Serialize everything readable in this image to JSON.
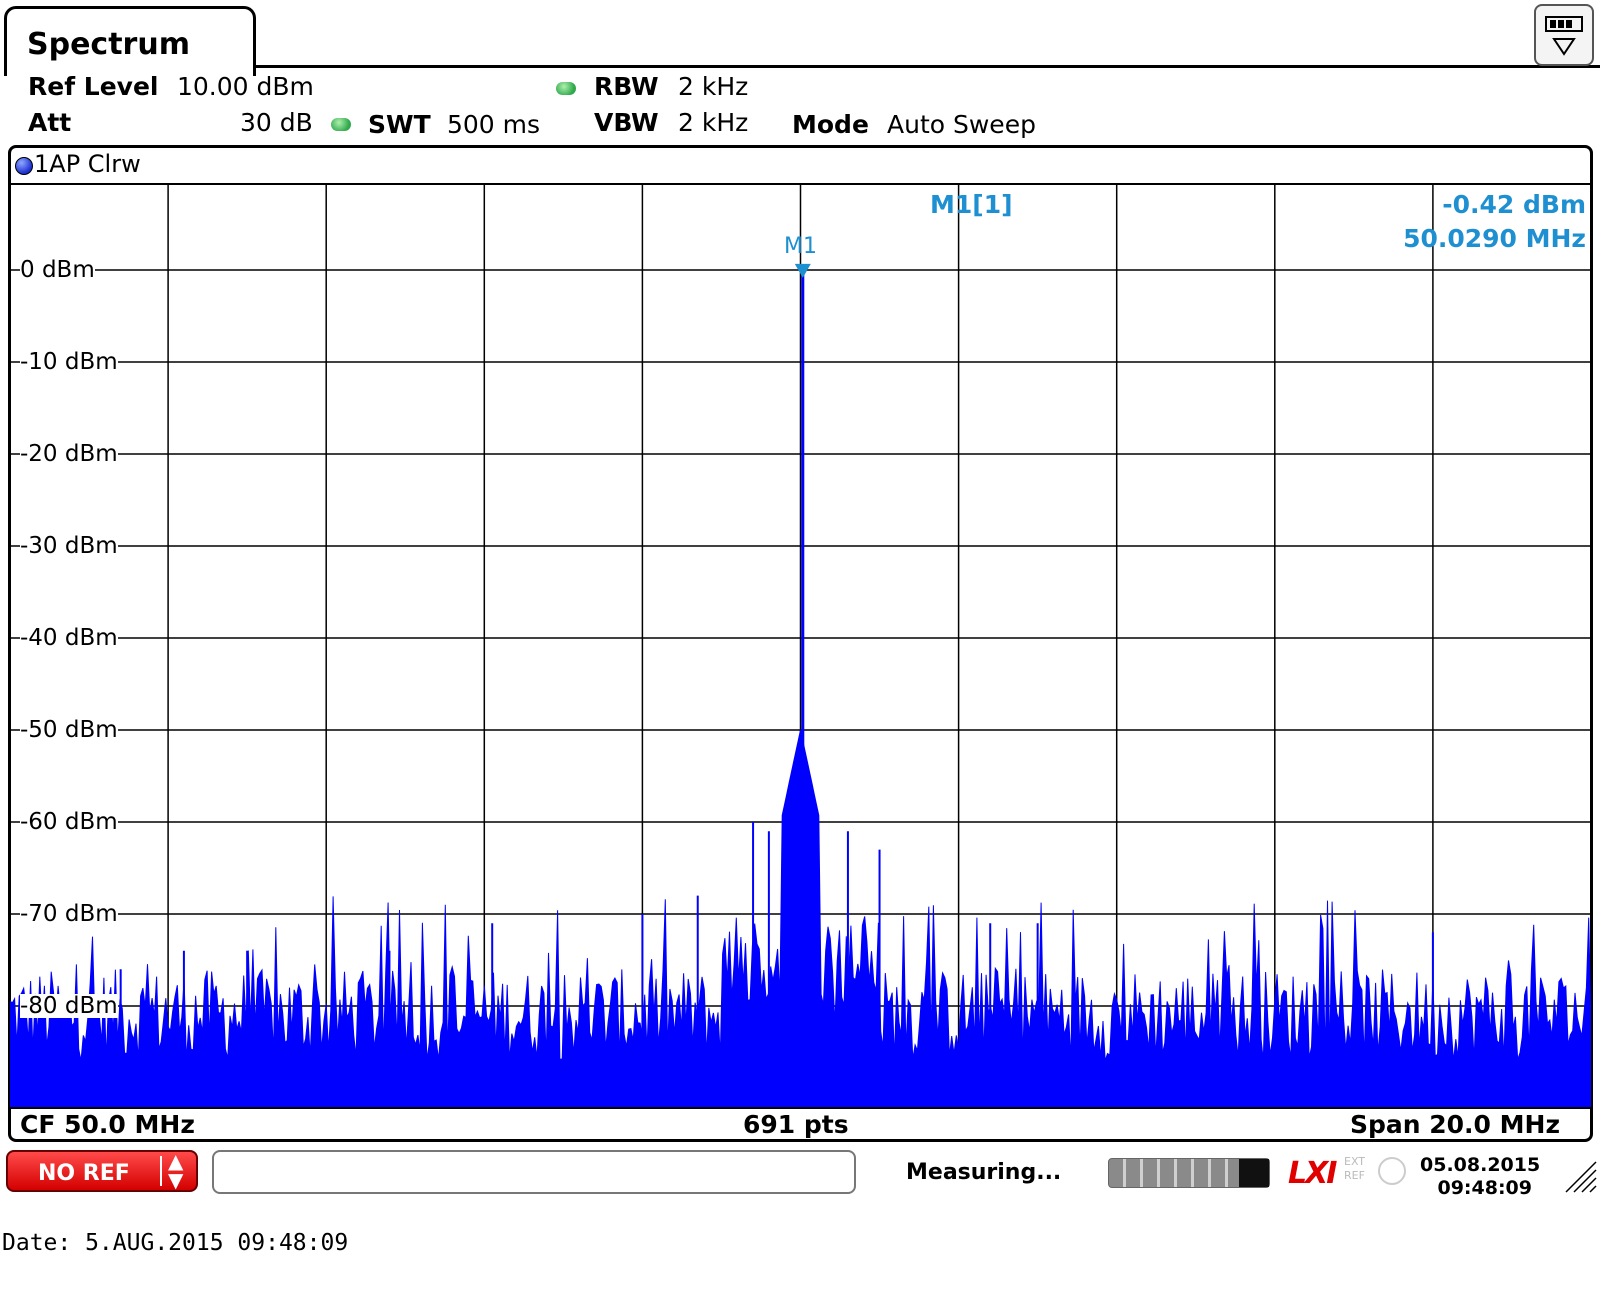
{
  "tab": {
    "title": "Spectrum"
  },
  "header": {
    "ref_level_label": "Ref Level",
    "ref_level_value": "10.00 dBm",
    "att_label": "Att",
    "att_value": "30 dB",
    "swt_label": "SWT",
    "swt_value": "500 ms",
    "rbw_label": "RBW",
    "rbw_value": "2 kHz",
    "vbw_label": "VBW",
    "vbw_value": "2 kHz",
    "mode_label": "Mode",
    "mode_value": "Auto Sweep"
  },
  "trace": {
    "label": "1AP Clrw",
    "color": "#0000ff"
  },
  "marker": {
    "name": "M1",
    "readout_name": "M1[1]",
    "level": "-0.42 dBm",
    "frequency": "50.0290 MHz",
    "color": "#1e8fd0"
  },
  "y_axis_labels": [
    "0 dBm",
    "-10 dBm",
    "-20 dBm",
    "-30 dBm",
    "-40 dBm",
    "-50 dBm",
    "-60 dBm",
    "-70 dBm",
    "-80 dBm"
  ],
  "footer": {
    "cf": "CF 50.0 MHz",
    "pts": "691 pts",
    "span": "Span 20.0 MHz"
  },
  "statusbar": {
    "noref": "NO REF",
    "status": "Measuring...",
    "date": "05.08.2015",
    "time": "09:48:09",
    "lxi": "LXI",
    "ext_ref": [
      "EXT",
      "REF"
    ]
  },
  "date_line": "Date: 5.AUG.2015   09:48:09",
  "chart_data": {
    "type": "line",
    "ylim": [
      -90,
      10
    ],
    "xlim_mhz": [
      40,
      60
    ],
    "center_mhz": 50.0,
    "span_mhz": 20.0,
    "points": 691,
    "grid": true,
    "noise_floor_dbm": -86,
    "peak": {
      "x_mhz": 50.029,
      "y_dbm": -0.42
    },
    "spurs": [
      {
        "x_mhz": 41.4,
        "y_dbm": -76
      },
      {
        "x_mhz": 42.2,
        "y_dbm": -74
      },
      {
        "x_mhz": 43.0,
        "y_dbm": -74
      },
      {
        "x_mhz": 44.8,
        "y_dbm": -74
      },
      {
        "x_mhz": 46.1,
        "y_dbm": -71
      },
      {
        "x_mhz": 48.0,
        "y_dbm": -70
      },
      {
        "x_mhz": 48.7,
        "y_dbm": -68
      },
      {
        "x_mhz": 49.4,
        "y_dbm": -60
      },
      {
        "x_mhz": 49.6,
        "y_dbm": -61
      },
      {
        "x_mhz": 49.9,
        "y_dbm": -55
      },
      {
        "x_mhz": 50.2,
        "y_dbm": -60
      },
      {
        "x_mhz": 50.6,
        "y_dbm": -61
      },
      {
        "x_mhz": 51.0,
        "y_dbm": -63
      },
      {
        "x_mhz": 52.4,
        "y_dbm": -71
      },
      {
        "x_mhz": 53.0,
        "y_dbm": -71
      },
      {
        "x_mhz": 58.0,
        "y_dbm": -72
      }
    ]
  }
}
